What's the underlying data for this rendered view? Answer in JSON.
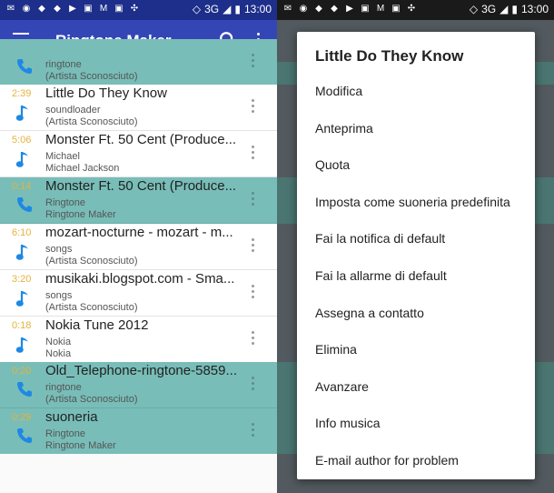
{
  "status_bar": {
    "network": "3G",
    "time": "13:00"
  },
  "app_bar": {
    "title": "Ringtone Maker"
  },
  "songs": [
    {
      "duration": "",
      "title": "",
      "line1": "ringtone",
      "line2": "(Artista Sconosciuto)",
      "icon": "phone-icon",
      "highlighted": true
    },
    {
      "duration": "2:39",
      "title": "Little Do They Know",
      "line1": "soundloader",
      "line2": "(Artista Sconosciuto)",
      "icon": "music-note-icon",
      "highlighted": false
    },
    {
      "duration": "5:06",
      "title": "Monster Ft. 50 Cent (Produce...",
      "line1": "Michael",
      "line2": "Michael Jackson",
      "icon": "music-note-icon",
      "highlighted": false
    },
    {
      "duration": "0:14",
      "title": "Monster Ft. 50 Cent (Produce...",
      "line1": "Ringtone",
      "line2": "Ringtone Maker",
      "icon": "phone-icon",
      "highlighted": true
    },
    {
      "duration": "6:10",
      "title": "mozart-nocturne - mozart - m...",
      "line1": "songs",
      "line2": "(Artista Sconosciuto)",
      "icon": "music-note-icon",
      "highlighted": false
    },
    {
      "duration": "3:20",
      "title": "musikaki.blogspot.com - Sma...",
      "line1": "songs",
      "line2": "(Artista Sconosciuto)",
      "icon": "music-note-icon",
      "highlighted": false
    },
    {
      "duration": "0:18",
      "title": "Nokia Tune 2012",
      "line1": "Nokia",
      "line2": "Nokia",
      "icon": "music-note-icon",
      "highlighted": false
    },
    {
      "duration": "0:20",
      "title": "Old_Telephone-ringtone-5859...",
      "line1": "ringtone",
      "line2": "(Artista Sconosciuto)",
      "icon": "phone-icon",
      "highlighted": true
    },
    {
      "duration": "0:29",
      "title": "suoneria",
      "line1": "Ringtone",
      "line2": "Ringtone Maker",
      "icon": "phone-icon",
      "highlighted": true
    }
  ],
  "dialog": {
    "title": "Little Do They Know",
    "items": [
      "Modifica",
      "Anteprima",
      "Quota",
      "Imposta come suoneria predefinita",
      "Fai la notifica di default",
      "Fai la allarme di default",
      "Assegna a contatto",
      "Elimina",
      "Avanzare",
      "Info musica",
      "E-mail author for problem"
    ]
  },
  "colors": {
    "status_bar": "#1d2f8a",
    "app_bar": "#3446b6",
    "highlight_row": "#78bdb8",
    "duration": "#e5b33d",
    "icon": "#1e88e5"
  }
}
